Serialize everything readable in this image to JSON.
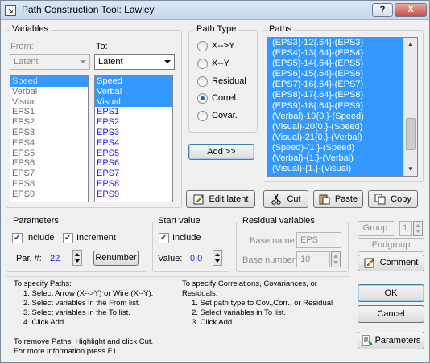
{
  "window": {
    "title": "Path Construction Tool: Lawley",
    "help_button": "?",
    "close_button": "X"
  },
  "variables": {
    "group_label": "Variables",
    "from_label": "From:",
    "to_label": "To:",
    "from_select": "Latent",
    "to_select": "Latent",
    "from_items": [
      "Speed",
      "Verbal",
      "Visual",
      "EPS1",
      "EPS2",
      "EPS3",
      "EPS4",
      "EPS5",
      "EPS6",
      "EPS7",
      "EPS8",
      "EPS9"
    ],
    "to_items": [
      "Speed",
      "Verbal",
      "Visual",
      "EPS1",
      "EPS2",
      "EPS3",
      "EPS4",
      "EPS5",
      "EPS6",
      "EPS7",
      "EPS8",
      "EPS9"
    ]
  },
  "path_type": {
    "group_label": "Path Type",
    "options": [
      "X-->Y",
      "X--Y",
      "Residual",
      "Correl.",
      "Covar."
    ],
    "selected": "Correl."
  },
  "paths": {
    "group_label": "Paths",
    "items": [
      "(EPS3)-12{.64}-(EPS3)",
      "(EPS4)-13{.64}-(EPS4)",
      "(EPS5)-14{.64}-(EPS5)",
      "(EPS6)-15{.64}-(EPS6)",
      "(EPS7)-16{.64}-(EPS7)",
      "(EPS8)-17{.64}-(EPS8)",
      "(EPS9)-18{.64}-(EPS9)",
      "(Verbal)-19{0.}-(Speed)",
      "(Visual)-20{0.}-(Speed)",
      "(Visual)-21{0.}-(Verbal)",
      "(Speed)-{1.}-(Speed)",
      "(Verbal)-{1.}-(Verbal)",
      "(Visual)-{1.}-(Visual)"
    ]
  },
  "buttons": {
    "add": "Add >>",
    "edit_latent": "Edit latent",
    "cut": "Cut",
    "paste": "Paste",
    "copy": "Copy",
    "renumber": "Renumber",
    "endgroup": "Endgroup",
    "comment": "Comment",
    "ok": "OK",
    "cancel": "Cancel",
    "parameters": "Parameters"
  },
  "parameters": {
    "group_label": "Parameters",
    "include_label": "Include",
    "include_checked": true,
    "increment_label": "Increment",
    "increment_checked": true,
    "par_label": "Par. #:",
    "par_value": "22"
  },
  "start_value": {
    "group_label": "Start value",
    "include_label": "Include",
    "include_checked": true,
    "value_label": "Value:",
    "value": "0.0"
  },
  "residual": {
    "group_label": "Residual variables",
    "base_name_label": "Base name:",
    "base_name_value": "EPS",
    "base_number_label": "Base number:",
    "base_number_value": "10"
  },
  "group_ctrl": {
    "label": "Group:",
    "value": "1"
  },
  "help_left": [
    "To specify Paths:",
    "1. Select Arrow (X-->Y) or Wire (X--Y).",
    "2. Select variables in the From list.",
    "3. Select variables in the To list.",
    "4. Click Add.",
    "",
    "To remove Paths: Highlight and click Cut.",
    "For more information press F1."
  ],
  "help_right": [
    "To specify Correlations, Covariances, or",
    "Residuals:",
    "1. Set path type to Cov.,Corr., or Residual",
    "2. Select variables in To list.",
    "3. Click Add."
  ]
}
